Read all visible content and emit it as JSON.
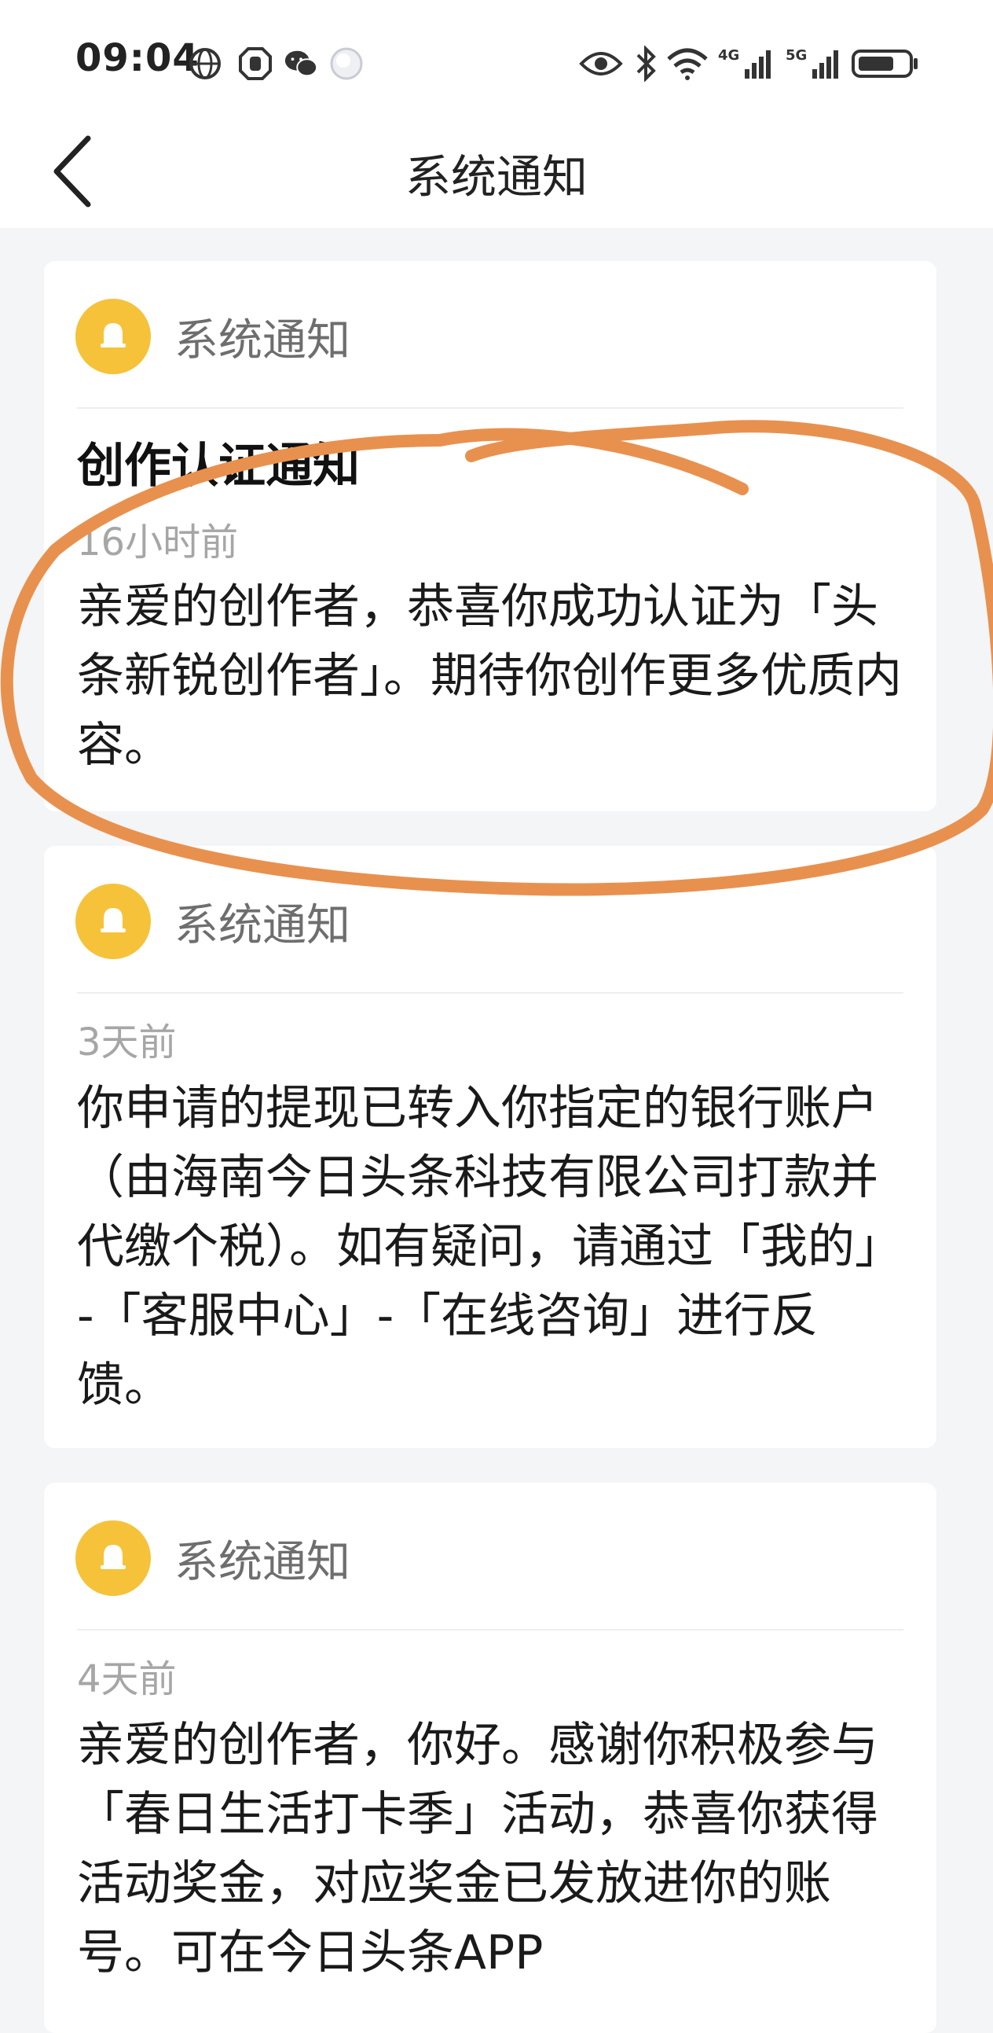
{
  "status_bar": {
    "time": "09:04",
    "network_4g": "4G",
    "network_5g": "5G"
  },
  "nav": {
    "title": "系统通知"
  },
  "notifications": [
    {
      "source": "系统通知",
      "title": "创作认证通知",
      "time": "16小时前",
      "body": "亲爱的创作者，恭喜你成功认证为「头条新锐创作者」。期待你创作更多优质内容。"
    },
    {
      "source": "系统通知",
      "time": "3天前",
      "body": "你申请的提现已转入你指定的银行账户（由海南今日头条科技有限公司打款并代缴个税）。如有疑问，请通过「我的」-「客服中心」-「在线咨询」进行反馈。"
    },
    {
      "source": "系统通知",
      "time": "4天前",
      "body": "亲爱的创作者，你好。感谢你积极参与「春日生活打卡季」活动，恭喜你获得活动奖金，对应奖金已发放进你的账号。可在今日头条APP"
    }
  ],
  "colors": {
    "page_background": "#f4f5f6",
    "bell_yellow": "#f6c23a",
    "annotation_orange": "#e8914f"
  },
  "icons": [
    "back-arrow-icon",
    "bell-icon",
    "eye-icon",
    "bluetooth-icon",
    "wifi-icon",
    "signal-icon",
    "battery-icon",
    "globe-icon",
    "hand-icon",
    "wechat-icon",
    "moon-icon"
  ]
}
